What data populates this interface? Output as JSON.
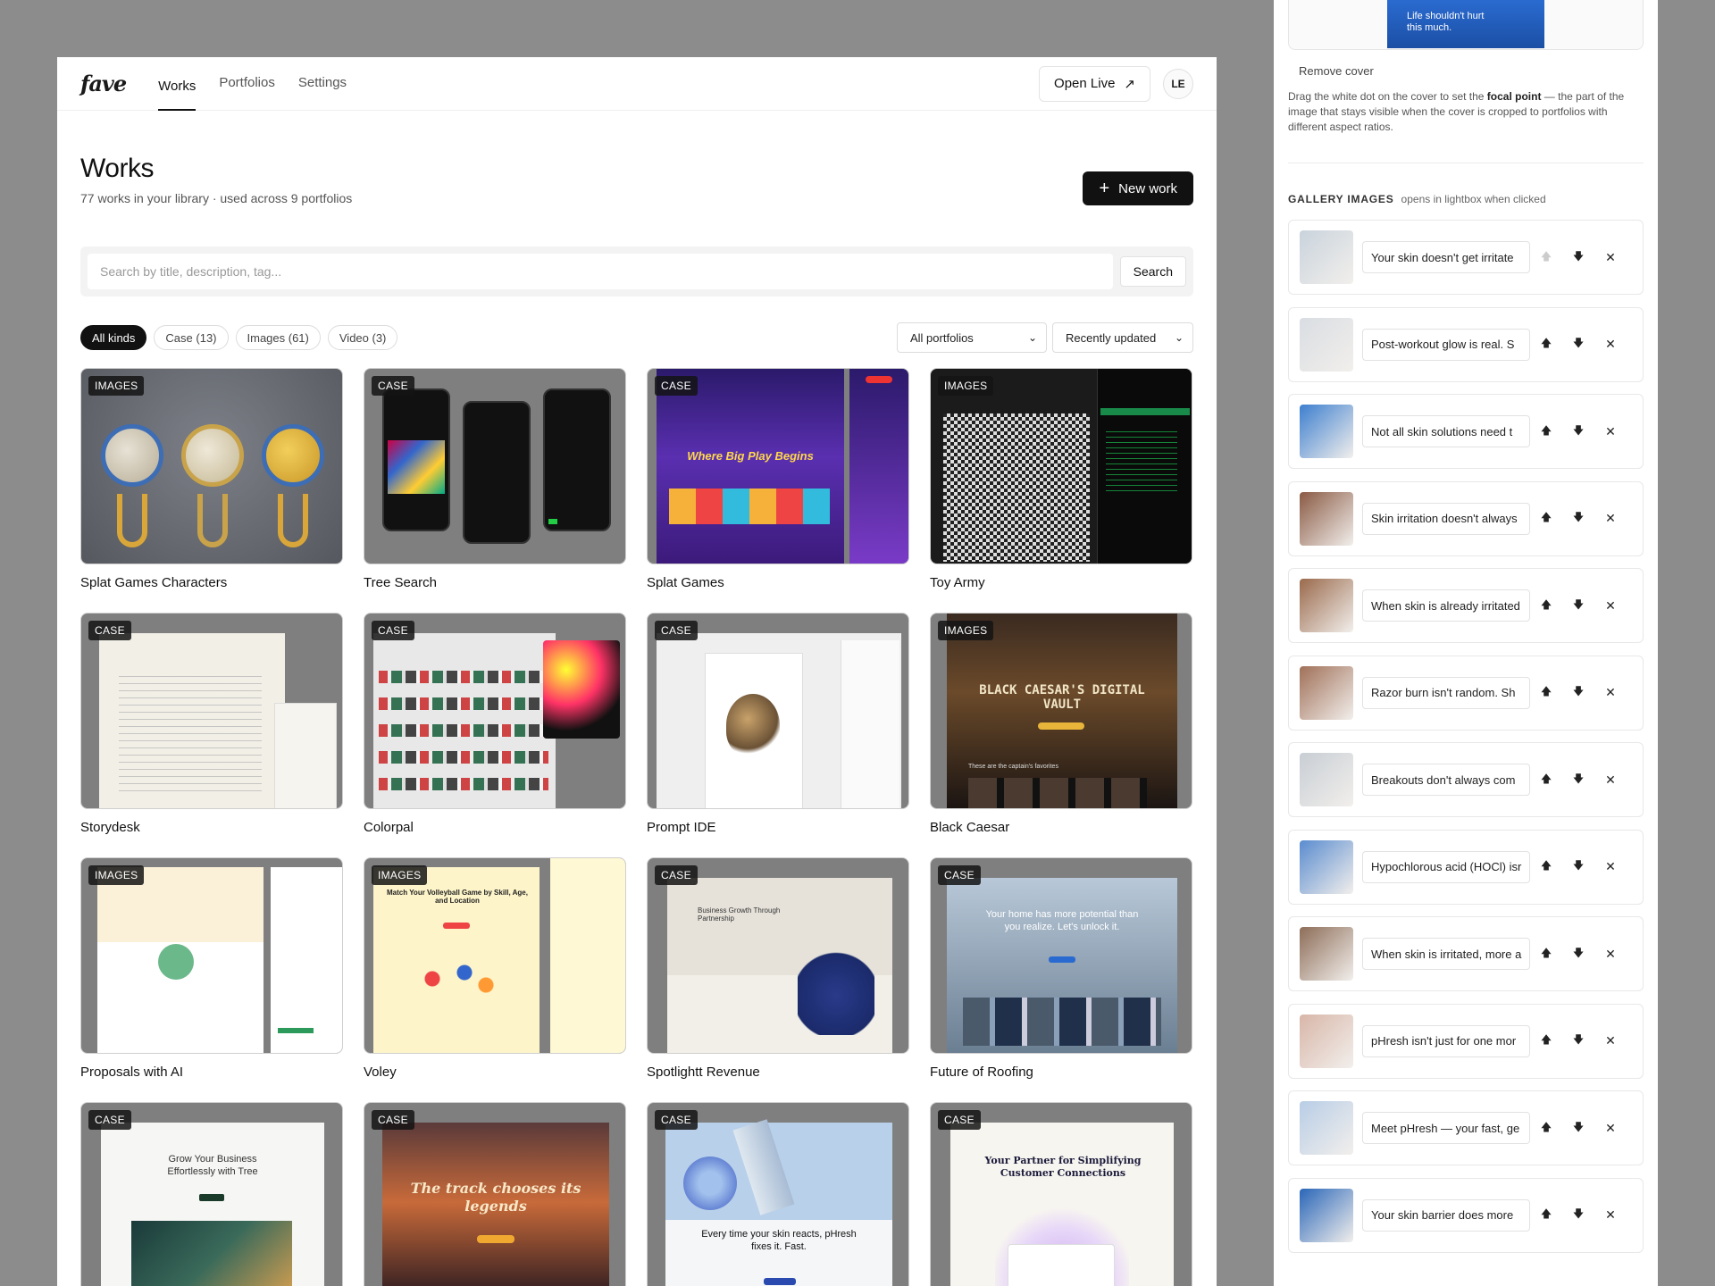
{
  "app": {
    "logo": "fave"
  },
  "nav": {
    "items": [
      "Works",
      "Portfolios",
      "Settings"
    ],
    "active": "Works"
  },
  "topbar": {
    "open_live": "Open Live",
    "open_live_icon": "↗",
    "avatar": "LE"
  },
  "header": {
    "title": "Works",
    "subtitle": "77 works in your library · used across 9 portfolios",
    "new_work": "New work"
  },
  "search": {
    "placeholder": "Search by title, description, tag...",
    "button": "Search"
  },
  "filters": {
    "chips": [
      "All kinds",
      "Case (13)",
      "Images (61)",
      "Video (3)"
    ],
    "portfolio_select": "All portfolios",
    "sort_select": "Recently updated"
  },
  "works": [
    {
      "title": "Splat Games Characters",
      "kind": "IMAGES"
    },
    {
      "title": "Tree Search",
      "kind": "CASE"
    },
    {
      "title": "Splat Games",
      "kind": "CASE"
    },
    {
      "title": "Toy Army",
      "kind": "IMAGES"
    },
    {
      "title": "Storydesk",
      "kind": "CASE"
    },
    {
      "title": "Colorpal",
      "kind": "CASE"
    },
    {
      "title": "Prompt IDE",
      "kind": "CASE"
    },
    {
      "title": "Black Caesar",
      "kind": "IMAGES"
    },
    {
      "title": "Proposals with AI",
      "kind": "IMAGES"
    },
    {
      "title": "Voley",
      "kind": "IMAGES"
    },
    {
      "title": "Spotlightt Revenue",
      "kind": "CASE"
    },
    {
      "title": "Future of Roofing",
      "kind": "CASE"
    },
    {
      "title": "",
      "kind": "CASE"
    },
    {
      "title": "",
      "kind": "CASE"
    },
    {
      "title": "",
      "kind": "CASE"
    },
    {
      "title": "",
      "kind": "CASE"
    }
  ],
  "thumb_text": {
    "splat_headline": "Where Big Play Begins",
    "caesar_headline": "BLACK CAESAR'S DIGITAL VAULT",
    "caesar_footer": "These are the captain's favorites",
    "roofing_headline": "Your home has more potential than you realize. Let's unlock it.",
    "tree_headline": "Grow Your Business Effortlessly with Tree",
    "track_headline": "The track chooses its legends",
    "phresh_headline": "Every time your skin reacts, pHresh fixes it. Fast.",
    "partner_headline": "Your Partner for Simplifying Customer Connections",
    "voley_headline": "Match Your Volleyball Game by Skill, Age, and Location",
    "spotlight_headline": "Business Growth Through Partnership",
    "cover_text": "Life shouldn't hurt this much."
  },
  "side": {
    "remove_cover": "Remove cover",
    "hint_prefix": "Drag the white dot on the cover to set the ",
    "hint_bold": "focal point",
    "hint_suffix": " — the part of the image that stays visible when the cover is cropped to portfolios with different aspect ratios.",
    "gallery_title": "GALLERY IMAGES",
    "gallery_note": "opens in lightbox when clicked",
    "gallery": [
      {
        "caption": "Your skin doesn't get irritate",
        "color": "#c9d3dc"
      },
      {
        "caption": "Post-workout glow is real. S",
        "color": "#d9dde2"
      },
      {
        "caption": "Not all skin solutions need t",
        "color": "#3d7fcf"
      },
      {
        "caption": "Skin irritation doesn't always",
        "color": "#8a5a44"
      },
      {
        "caption": "When skin is already irritated",
        "color": "#9a6a4c"
      },
      {
        "caption": "Razor burn isn't random. Sh",
        "color": "#a07058"
      },
      {
        "caption": "Breakouts don't always com",
        "color": "#c8ced4"
      },
      {
        "caption": "Hypochlorous acid (HOCl) isr",
        "color": "#5a8ccf"
      },
      {
        "caption": "When skin is irritated, more a",
        "color": "#8d6d58"
      },
      {
        "caption": "pHresh isn't just for one mor",
        "color": "#d8b6a8"
      },
      {
        "caption": "Meet pHresh — your fast, ge",
        "color": "#b8cde6"
      },
      {
        "caption": "Your skin barrier does more",
        "color": "#2a66b8"
      }
    ],
    "move_up": "🡅",
    "move_down": "🡇",
    "remove": "✕"
  },
  "colors": {
    "accent": "#111111",
    "panel_bg": "#8c8c8c"
  }
}
